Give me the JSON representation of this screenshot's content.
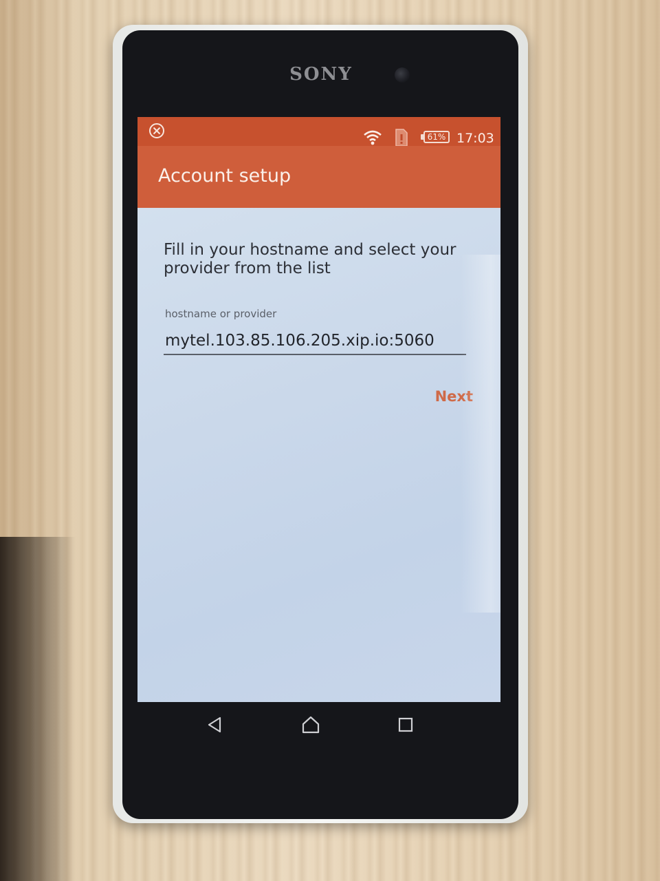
{
  "device": {
    "brand": "SONY"
  },
  "status_bar": {
    "battery_percent": "61%",
    "time": "17:03",
    "icons": [
      "close-circle-icon",
      "wifi-icon",
      "sim-card-icon",
      "battery-icon"
    ]
  },
  "app_bar": {
    "title": "Account setup",
    "color": "#cf5e3b"
  },
  "form": {
    "instructions": "Fill in your hostname and select your provider from the list",
    "field_label": "hostname or provider",
    "hostname_value": "mytel.103.85.106.205.xip.io:5060",
    "next_label": "Next",
    "accent_color": "#cf6a48"
  },
  "nav_bar": {
    "icons": [
      "back-icon",
      "home-icon",
      "recents-icon"
    ]
  }
}
